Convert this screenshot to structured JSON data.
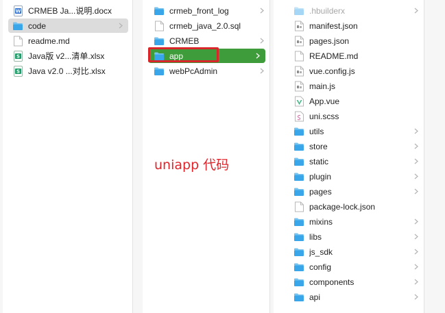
{
  "colors": {
    "folder_top": "#76c2ef",
    "folder_body": "#3aa6ea",
    "selection_green": "#3f9c3a",
    "selection_grey": "#dcdcdc",
    "annotation_red": "#e0242b"
  },
  "column1": [
    {
      "label": "CRMEB Ja...说明.docx",
      "icon": "word-doc-icon",
      "chevron": false,
      "state": "normal"
    },
    {
      "label": "code",
      "icon": "folder-icon",
      "chevron": true,
      "state": "grey"
    },
    {
      "label": "readme.md",
      "icon": "document-icon",
      "chevron": false,
      "state": "normal"
    },
    {
      "label": "Java版 v2...清单.xlsx",
      "icon": "spreadsheet-icon",
      "chevron": false,
      "state": "normal"
    },
    {
      "label": "Java v2.0 ...对比.xlsx",
      "icon": "spreadsheet-icon",
      "chevron": false,
      "state": "normal"
    }
  ],
  "column2": [
    {
      "label": "crmeb_front_log",
      "icon": "folder-icon",
      "chevron": true,
      "state": "normal"
    },
    {
      "label": "crmeb_java_2.0.sql",
      "icon": "document-icon",
      "chevron": false,
      "state": "normal"
    },
    {
      "label": "CRMEB",
      "icon": "folder-icon",
      "chevron": true,
      "state": "normal"
    },
    {
      "label": "app",
      "icon": "folder-icon",
      "chevron": true,
      "state": "selected"
    },
    {
      "label": "webPcAdmin",
      "icon": "folder-icon",
      "chevron": true,
      "state": "normal"
    }
  ],
  "column3": [
    {
      "label": ".hbuilderx",
      "icon": "folder-icon",
      "chevron": true,
      "state": "dim"
    },
    {
      "label": "manifest.json",
      "icon": "json-file-icon",
      "chevron": false,
      "state": "normal"
    },
    {
      "label": "pages.json",
      "icon": "json-file-icon",
      "chevron": false,
      "state": "normal"
    },
    {
      "label": "README.md",
      "icon": "document-icon",
      "chevron": false,
      "state": "normal"
    },
    {
      "label": "vue.config.js",
      "icon": "js-file-icon",
      "chevron": false,
      "state": "normal"
    },
    {
      "label": "main.js",
      "icon": "js-file-icon",
      "chevron": false,
      "state": "normal"
    },
    {
      "label": "App.vue",
      "icon": "vue-file-icon",
      "chevron": false,
      "state": "normal"
    },
    {
      "label": "uni.scss",
      "icon": "scss-file-icon",
      "chevron": false,
      "state": "normal"
    },
    {
      "label": "utils",
      "icon": "folder-icon",
      "chevron": true,
      "state": "normal"
    },
    {
      "label": "store",
      "icon": "folder-icon",
      "chevron": true,
      "state": "normal"
    },
    {
      "label": "static",
      "icon": "folder-icon",
      "chevron": true,
      "state": "normal"
    },
    {
      "label": "plugin",
      "icon": "folder-icon",
      "chevron": true,
      "state": "normal"
    },
    {
      "label": "pages",
      "icon": "folder-icon",
      "chevron": true,
      "state": "normal"
    },
    {
      "label": "package-lock.json",
      "icon": "document-icon",
      "chevron": false,
      "state": "normal"
    },
    {
      "label": "mixins",
      "icon": "folder-icon",
      "chevron": true,
      "state": "normal"
    },
    {
      "label": "libs",
      "icon": "folder-icon",
      "chevron": true,
      "state": "normal"
    },
    {
      "label": "js_sdk",
      "icon": "folder-icon",
      "chevron": true,
      "state": "normal"
    },
    {
      "label": "config",
      "icon": "folder-icon",
      "chevron": true,
      "state": "normal"
    },
    {
      "label": "components",
      "icon": "folder-icon",
      "chevron": true,
      "state": "normal"
    },
    {
      "label": "api",
      "icon": "folder-icon",
      "chevron": true,
      "state": "normal"
    }
  ],
  "annotation": {
    "text": "uniapp 代码"
  }
}
